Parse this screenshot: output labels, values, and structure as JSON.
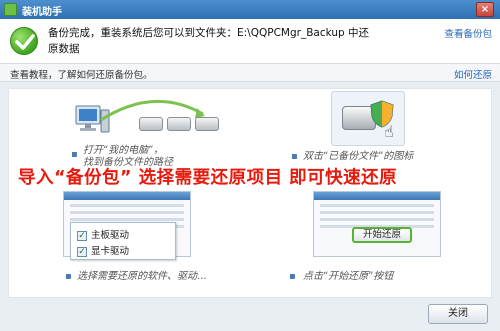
{
  "window": {
    "title": "装机助手",
    "close_glyph": "×"
  },
  "header": {
    "message": "备份完成，重装系统后您可以到文件夹：E:\\QQPCMgr_Backup 中还原数据",
    "view_backup_link": "查看备份包"
  },
  "infobar": {
    "text": "查看教程，了解如何还原备份包。",
    "link": "如何还原"
  },
  "tutorial": {
    "step1_line1": "打开“我的电脑”，",
    "step1_line2": "找到备份文件的路径",
    "step2": "双击“已备份文件”的图标",
    "banner": "导入“备份包” 选择需要还原项目 即可快速还原",
    "drivers": [
      {
        "label": "主板驱动",
        "checked": true
      },
      {
        "label": "显卡驱动",
        "checked": true
      }
    ],
    "step3": "选择需要还原的软件、驱动...",
    "start_restore_label": "开始还原",
    "step4": "点击“开始还原”按钮"
  },
  "footer": {
    "close_label": "关闭"
  },
  "colors": {
    "accent": "#2e6fb3",
    "banner_red": "#e8190d",
    "success_green": "#3fa420"
  }
}
